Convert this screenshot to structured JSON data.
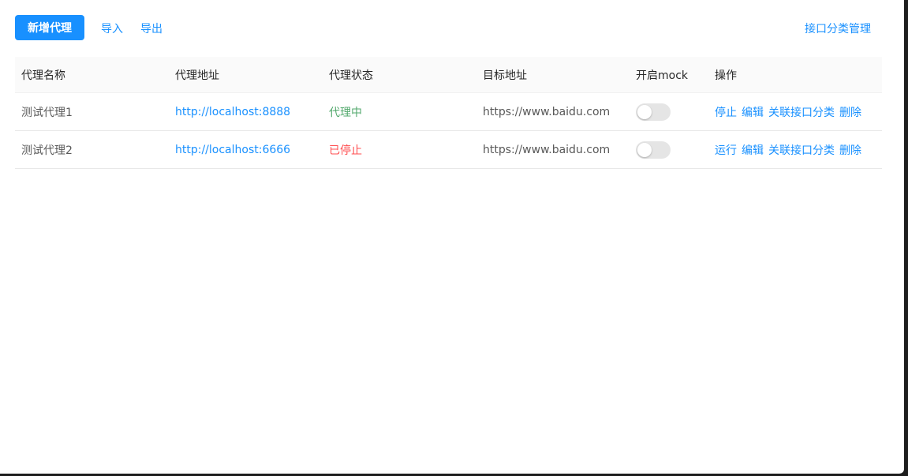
{
  "toolbar": {
    "add_proxy_label": "新增代理",
    "import_label": "导入",
    "export_label": "导出",
    "category_manage_label": "接口分类管理"
  },
  "table": {
    "columns": [
      "代理名称",
      "代理地址",
      "代理状态",
      "目标地址",
      "开启mock",
      "操作"
    ],
    "rows": [
      {
        "name": "测试代理1",
        "address": "http://localhost:8888",
        "status": "代理中",
        "status_color": "#52a86c",
        "target": "https://www.baidu.com",
        "mock_enabled": false,
        "actions": [
          "停止",
          "编辑",
          "关联接口分类",
          "删除"
        ]
      },
      {
        "name": "测试代理2",
        "address": "http://localhost:6666",
        "status": "已停止",
        "status_color": "#ff4d4f",
        "target": "https://www.baidu.com",
        "mock_enabled": false,
        "actions": [
          "运行",
          "编辑",
          "关联接口分类",
          "删除"
        ]
      }
    ]
  },
  "colors": {
    "primary": "#1890ff"
  }
}
